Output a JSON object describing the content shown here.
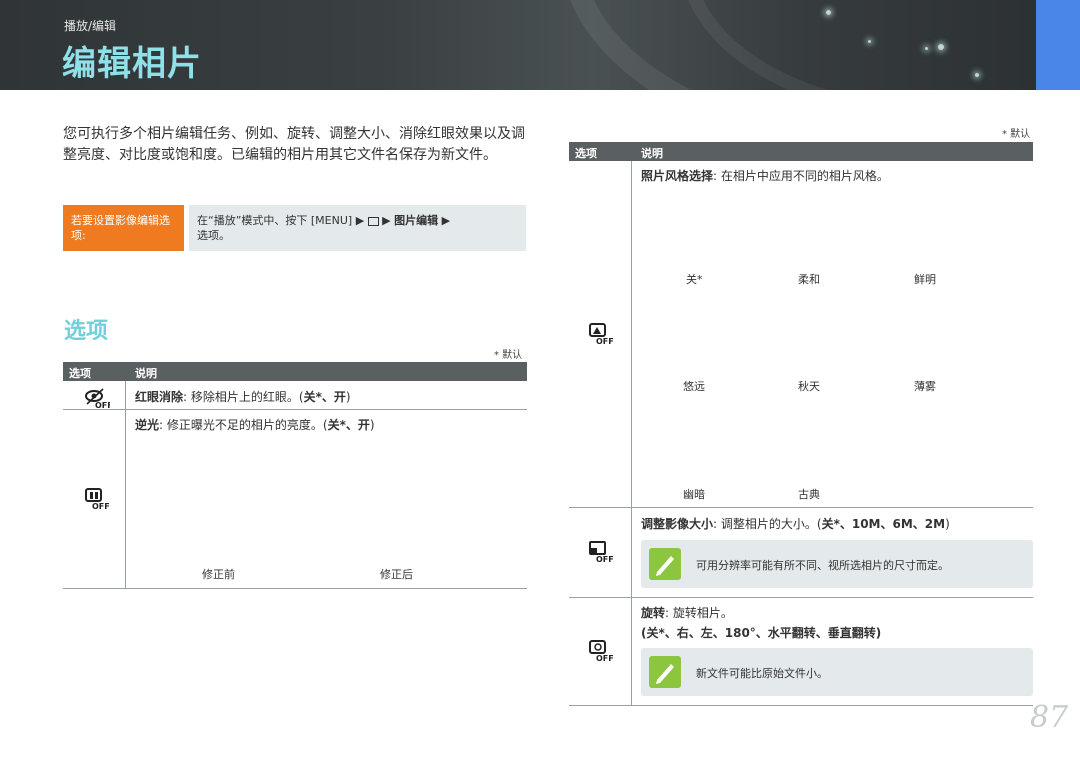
{
  "header": {
    "breadcrumb": "播放/编辑",
    "title": "编辑相片"
  },
  "intro": "您可执行多个相片编辑任务、例如、旋转、调整大小、消除红眼效果以及调整亮度、对比度或饱和度。已编辑的相片用其它文件名保存为新文件。",
  "howto": {
    "label": "若要设置影像编辑选项:",
    "body_prefix": "在“播放”模式中、按下 [MENU]",
    "body_item": "图片编辑",
    "body_suffix": "选项。"
  },
  "section_title": "选项",
  "default_note": "* 默认",
  "table_headers": {
    "option": "选项",
    "desc": "说明"
  },
  "left_rows": {
    "redeye_title": "红眼消除",
    "redeye_desc": ": 移除相片上的红眼。(",
    "redeye_vals": "关*、开",
    "backlight_title": "逆光",
    "backlight_desc": ": 修正曝光不足的相片的亮度。(",
    "backlight_vals": "关*、开",
    "before": "修正前",
    "after": "修正后"
  },
  "right_rows": {
    "style_title": "照片风格选择",
    "style_desc": ": 在相片中应用不同的相片风格。",
    "styles": [
      "关*",
      "柔和",
      "鲜明",
      "悠远",
      "秋天",
      "薄雾",
      "幽暗",
      "古典"
    ],
    "resize_title": "调整影像大小",
    "resize_desc": ": 调整相片的大小。(",
    "resize_vals": "关*、10M、6M、2M",
    "resize_note": "可用分辨率可能有所不同、视所选相片的尺寸而定。",
    "rotate_title": "旋转",
    "rotate_desc": ": 旋转相片。",
    "rotate_vals": "(关*、右、左、180°、水平翻转、垂直翻转)",
    "rotate_note": "新文件可能比原始文件小。"
  },
  "icons": [
    "redeye-off-icon",
    "backlight-off-icon",
    "photo-style-off-icon",
    "resize-off-icon",
    "rotate-off-icon",
    "note-pen-icon",
    "arrow-right-icon",
    "playback-icon"
  ],
  "page_number": "87",
  "colors": {
    "accent_teal": "#6fd0da",
    "orange": "#f07a1f",
    "note_green": "#8cc63f",
    "blue_tab": "#4a86e8"
  }
}
